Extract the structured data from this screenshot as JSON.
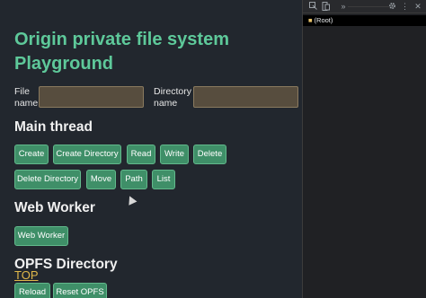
{
  "page": {
    "title": "Origin private file system Playground"
  },
  "form": {
    "file_name_label": "File name",
    "file_name_value": "",
    "directory_name_label": "Directory name",
    "directory_name_value": ""
  },
  "main_thread": {
    "heading": "Main thread",
    "buttons": [
      "Create",
      "Create Directory",
      "Read",
      "Write",
      "Delete",
      "Delete Directory",
      "Move",
      "Path",
      "List"
    ]
  },
  "web_worker": {
    "heading": "Web Worker",
    "button": "Web Worker"
  },
  "opfs_directory": {
    "heading": "OPFS Directory",
    "top_link": "TOP",
    "buttons": [
      "Reload",
      "Reset OPFS"
    ]
  },
  "devtools": {
    "toolbar_icons": [
      "inspect-icon",
      "device-icon",
      "more-tabs-icon",
      "settings-icon",
      "kebab-icon",
      "close-icon"
    ],
    "tree_root_label": "(Root)",
    "tree_root_icon": "folder-icon"
  },
  "colors": {
    "accent": "#5ec99a",
    "button_bg": "#3f8f68",
    "input_bg": "#574d3e",
    "link": "#e0b84a"
  }
}
